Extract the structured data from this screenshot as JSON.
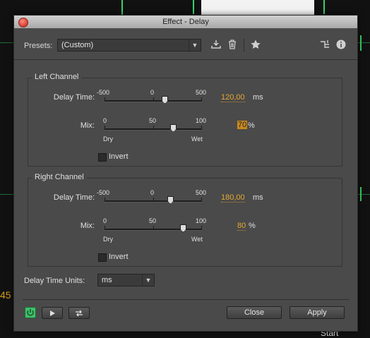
{
  "window": {
    "title": "Effect - Delay"
  },
  "presets": {
    "label": "Presets:",
    "value": "(Custom)"
  },
  "left_channel": {
    "title": "Left Channel",
    "delay_label": "Delay Time:",
    "delay_ticks": [
      "-500",
      "0",
      "500"
    ],
    "delay_value": "120,00",
    "delay_unit": "ms",
    "mix_label": "Mix:",
    "mix_ticks": [
      "0",
      "50",
      "100"
    ],
    "mix_dry": "Dry",
    "mix_wet": "Wet",
    "mix_value": "70",
    "mix_unit": "%",
    "invert_label": "Invert"
  },
  "right_channel": {
    "title": "Right Channel",
    "delay_label": "Delay Time:",
    "delay_ticks": [
      "-500",
      "0",
      "500"
    ],
    "delay_value": "180,00",
    "delay_unit": "ms",
    "mix_label": "Mix:",
    "mix_ticks": [
      "0",
      "50",
      "100"
    ],
    "mix_dry": "Dry",
    "mix_wet": "Wet",
    "mix_value": "80",
    "mix_unit": "%",
    "invert_label": "Invert"
  },
  "units": {
    "label": "Delay Time Units:",
    "value": "ms"
  },
  "footer": {
    "close_label": "Close",
    "apply_label": "Apply"
  },
  "background": {
    "left_number": "45",
    "start_label": "Start"
  },
  "colors": {
    "accent": "#e4a832",
    "power_on": "#3fbf6a"
  }
}
